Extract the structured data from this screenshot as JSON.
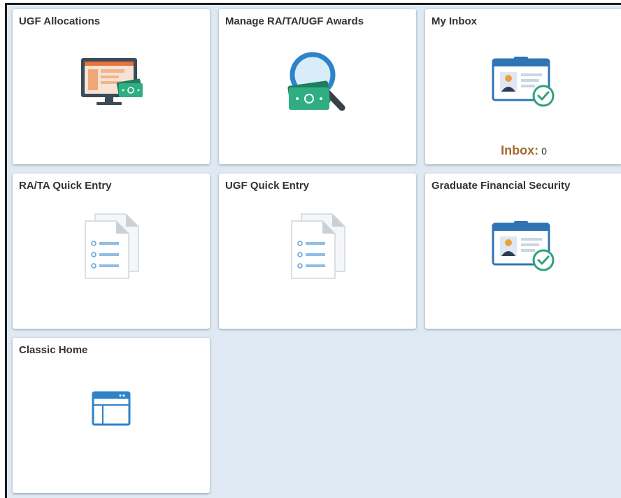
{
  "tiles": [
    {
      "id": "ugf-allocations",
      "title": "UGF Allocations",
      "icon": "monitor-money-icon"
    },
    {
      "id": "manage-awards",
      "title": "Manage RA/TA/UGF Awards",
      "icon": "magnifier-money-icon"
    },
    {
      "id": "my-inbox",
      "title": "My Inbox",
      "icon": "id-card-check-icon",
      "inbox_label": "Inbox:",
      "inbox_count": "0"
    },
    {
      "id": "ra-ta-quick-entry",
      "title": "RA/TA Quick Entry",
      "icon": "documents-list-icon"
    },
    {
      "id": "ugf-quick-entry",
      "title": "UGF Quick Entry",
      "icon": "documents-list-icon"
    },
    {
      "id": "graduate-financial-security",
      "title": "Graduate Financial Security",
      "icon": "id-card-check-icon"
    },
    {
      "id": "classic-home",
      "title": "Classic Home",
      "icon": "browser-window-icon"
    }
  ],
  "colors": {
    "background": "#dfe9f3",
    "tile": "#ffffff",
    "inbox_label": "#a36a2e",
    "icon_blue": "#2f75b5",
    "icon_green": "#2fa37a",
    "icon_orange": "#e9a23b"
  }
}
